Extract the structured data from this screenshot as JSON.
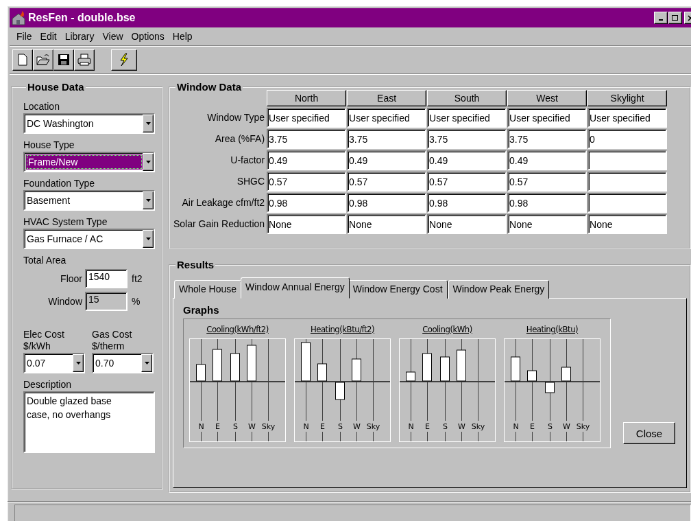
{
  "window": {
    "title": "ResFen - double.bse"
  },
  "menu": [
    "File",
    "Edit",
    "Library",
    "View",
    "Options",
    "Help"
  ],
  "house_data": {
    "title": "House Data",
    "fields": [
      {
        "label": "Location",
        "value": "DC Washington",
        "selected": false
      },
      {
        "label": "House Type",
        "value": "Frame/New",
        "selected": true
      },
      {
        "label": "Foundation Type",
        "value": "Basement",
        "selected": false
      },
      {
        "label": "HVAC System Type",
        "value": "Gas Furnace / AC",
        "selected": false
      }
    ],
    "total_area": {
      "label": "Total Area",
      "inputs": [
        {
          "label": "Floor",
          "value": "1540",
          "unit": "ft2",
          "disabled": false
        },
        {
          "label": "Window",
          "value": "15",
          "unit": "%",
          "disabled": true
        }
      ]
    },
    "costs": [
      {
        "label": "Elec Cost",
        "unit": "$/kWh",
        "value": "0.07"
      },
      {
        "label": "Gas Cost",
        "unit": "$/therm",
        "value": "0.70"
      }
    ],
    "description": {
      "label": "Description",
      "value": "Double glazed base case, no overhangs"
    }
  },
  "window_data": {
    "title": "Window Data",
    "columns": [
      "North",
      "East",
      "South",
      "West",
      "Skylight"
    ],
    "rows": [
      {
        "label": "Window Type",
        "cells": [
          "User specified",
          "User specified",
          "User specified",
          "User specified",
          "User specified"
        ]
      },
      {
        "label": "Area (%FA)",
        "cells": [
          "3.75",
          "3.75",
          "3.75",
          "3.75",
          "0"
        ]
      },
      {
        "label": "U-factor",
        "cells": [
          "0.49",
          "0.49",
          "0.49",
          "0.49"
        ]
      },
      {
        "label": "SHGC",
        "cells": [
          "0.57",
          "0.57",
          "0.57",
          "0.57"
        ]
      },
      {
        "label": "Air Leakage cfm/ft2",
        "cells": [
          "0.98",
          "0.98",
          "0.98",
          "0.98"
        ]
      },
      {
        "label": "Solar Gain Reduction",
        "cells": [
          "None",
          "None",
          "None",
          "None",
          "None"
        ]
      }
    ]
  },
  "results": {
    "title": "Results",
    "tabs": [
      {
        "label": "Whole House",
        "selected": false
      },
      {
        "label": "Window Annual Energy",
        "selected": true
      },
      {
        "label": "Window Energy Cost",
        "selected": false
      },
      {
        "label": "Window Peak Energy",
        "selected": false
      }
    ],
    "graphs_title": "Graphs",
    "graphs": [
      {
        "title": "Cooling(kWh/ft2)",
        "categories": [
          "N",
          "E",
          "S",
          "W",
          "Sky"
        ]
      },
      {
        "title": "Heating(kBtu/ft2)",
        "categories": [
          "N",
          "E",
          "S",
          "W",
          "Sky"
        ]
      },
      {
        "title": "Cooling(kWh)",
        "categories": [
          "N",
          "E",
          "S",
          "W",
          "Sky"
        ]
      },
      {
        "title": "Heating(kBtu)",
        "categories": [
          "N",
          "E",
          "S",
          "W",
          "Sky"
        ]
      }
    ],
    "close_button": "Close"
  }
}
